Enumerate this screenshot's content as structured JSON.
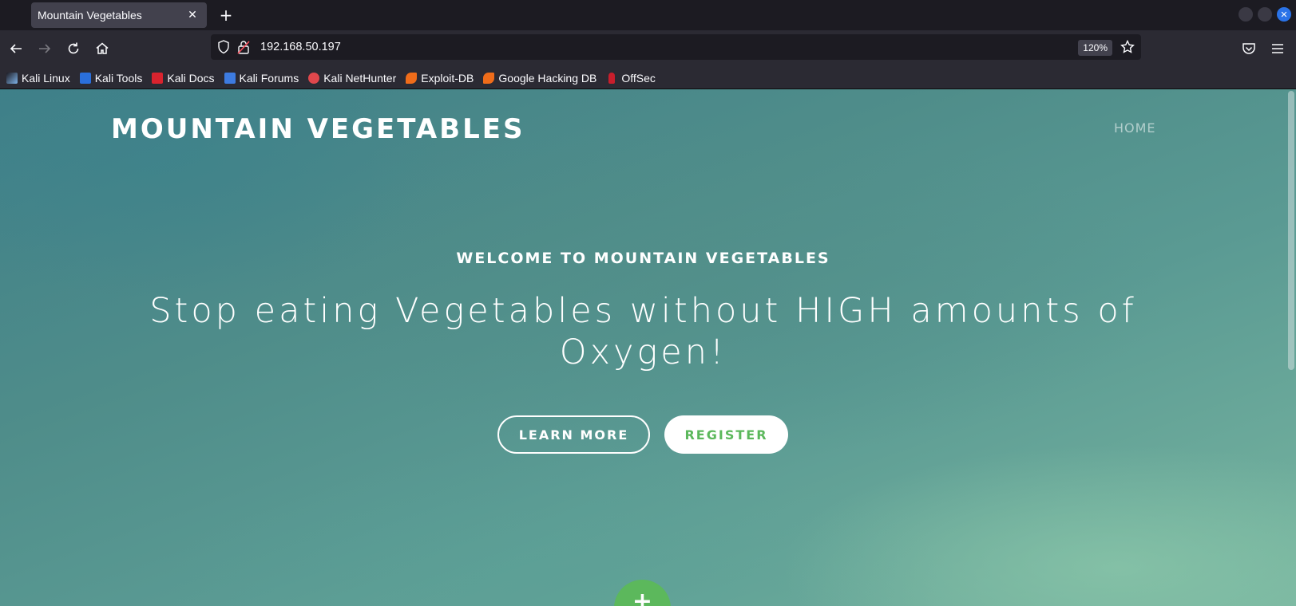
{
  "browser": {
    "tab": {
      "title": "Mountain Vegetables",
      "close_glyph": "✕"
    },
    "new_tab_glyph": "+",
    "window_close_glyph": "✕",
    "url": "192.168.50.197",
    "zoom": "120%",
    "bookmarks": [
      {
        "label": "Kali Linux",
        "icon": "kali-dragon-icon",
        "color": "#1c1b22"
      },
      {
        "label": "Kali Tools",
        "icon": "kali-tools-icon",
        "color": "#2a6fdb"
      },
      {
        "label": "Kali Docs",
        "icon": "kali-docs-icon",
        "color": "#d9232e"
      },
      {
        "label": "Kali Forums",
        "icon": "kali-forums-icon",
        "color": "#3d7be0"
      },
      {
        "label": "Kali NetHunter",
        "icon": "kali-nethunter-icon",
        "color": "#e0474c"
      },
      {
        "label": "Exploit-DB",
        "icon": "exploit-db-icon",
        "color": "#ef6c1a"
      },
      {
        "label": "Google Hacking DB",
        "icon": "ghdb-icon",
        "color": "#ef6c1a"
      },
      {
        "label": "OffSec",
        "icon": "offsec-icon",
        "color": "#c81e2c"
      }
    ]
  },
  "page": {
    "logo": "MOUNTAIN VEGETABLES",
    "nav_home": "HOME",
    "hero_subtitle": "WELCOME TO MOUNTAIN VEGETABLES",
    "hero_title": "Stop eating Vegetables without HIGH amounts of Oxygen!",
    "learn_more": "LEARN MORE",
    "register": "REGISTER",
    "fab_glyph": "+",
    "accent_color": "#5cb85c"
  }
}
